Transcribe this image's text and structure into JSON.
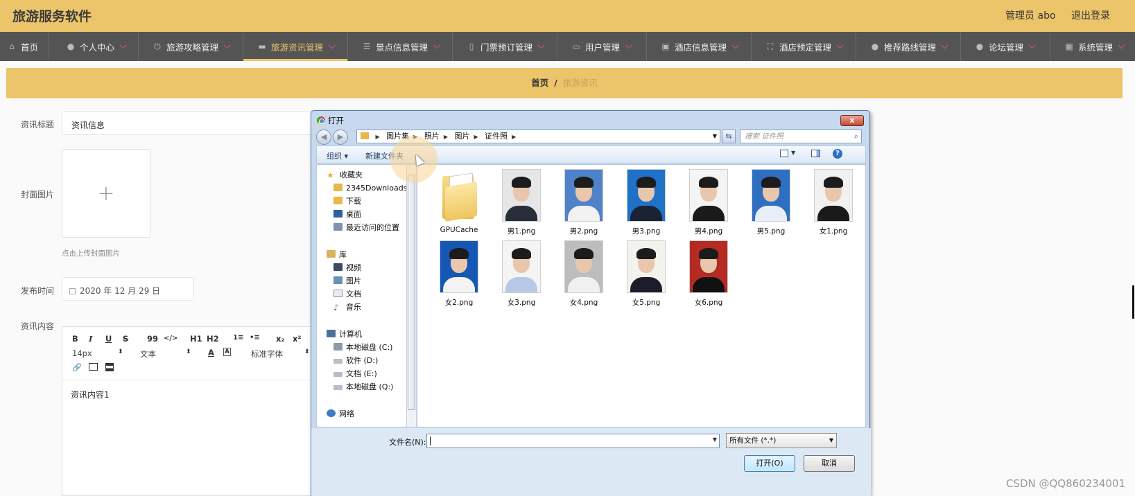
{
  "app": {
    "title": "旅游服务软件"
  },
  "user": {
    "name": "管理员 abo",
    "logout": "退出登录"
  },
  "nav": [
    {
      "label": "首页",
      "icon": "home-icon"
    },
    {
      "label": "个人中心",
      "icon": "user-icon"
    },
    {
      "label": "旅游攻略管理",
      "icon": "power-icon"
    },
    {
      "label": "旅游资讯管理",
      "icon": "news-icon"
    },
    {
      "label": "景点信息管理",
      "icon": "list-icon"
    },
    {
      "label": "门票预订管理",
      "icon": "mic-icon"
    },
    {
      "label": "用户管理",
      "icon": "chat-icon"
    },
    {
      "label": "酒店信息管理",
      "icon": "briefcase-icon"
    },
    {
      "label": "酒店预定管理",
      "icon": "fullscreen-icon"
    },
    {
      "label": "推荐路线管理",
      "icon": "person-icon"
    },
    {
      "label": "论坛管理",
      "icon": "person-icon"
    },
    {
      "label": "系统管理",
      "icon": "grid-icon"
    }
  ],
  "breadcrumb": {
    "home": "首页",
    "sep": "/",
    "current": "旅游资讯"
  },
  "form": {
    "title_label": "资讯标题",
    "title_value": "资讯信息",
    "cover_label": "封面图片",
    "upload_plus": "+",
    "upload_tip": "点击上传封面图片",
    "date_label": "发布时间",
    "date_value": "2020 年 12 月 29 日",
    "content_label": "资讯内容",
    "content_value": "资讯内容1",
    "toolbar": {
      "bold": "B",
      "italic": "I",
      "underline": "U",
      "strike": "S",
      "quote": "99",
      "code": "</>",
      "h1": "H1",
      "h2": "H2",
      "ol": "1≡",
      "ul": "•≡",
      "sub": "x₂",
      "sup": "x²",
      "size": "14px",
      "block": "文本",
      "font": "标准字体"
    }
  },
  "dialog": {
    "title": "打开",
    "close": "x",
    "path": [
      "图片集",
      "照片",
      "图片",
      "证件照"
    ],
    "search_placeholder": "搜索 证件照",
    "organize": "组织 ▾",
    "new_folder": "新建文件夹",
    "nav": {
      "favorites": "收藏夹",
      "fav_items": [
        "2345Downloads",
        "下载",
        "桌面",
        "最近访问的位置"
      ],
      "library": "库",
      "lib_items": [
        "视频",
        "图片",
        "文档",
        "音乐"
      ],
      "computer": "计算机",
      "drives": [
        "本地磁盘 (C:)",
        "软件 (D:)",
        "文档 (E:)",
        "本地磁盘 (Q:)"
      ],
      "network": "网络"
    },
    "files": [
      {
        "name": "GPUCache",
        "kind": "folder"
      },
      {
        "name": "男1.png",
        "kind": "photo",
        "bg": "#e6e6e6",
        "cloth": "#2a2d3a"
      },
      {
        "name": "男2.png",
        "kind": "photo",
        "bg": "#4f82c9",
        "cloth": "#f2f2f2"
      },
      {
        "name": "男3.png",
        "kind": "photo",
        "bg": "#1f72c8",
        "cloth": "#1b2233"
      },
      {
        "name": "男4.png",
        "kind": "photo",
        "bg": "#f4f4f4",
        "cloth": "#1a1a1a"
      },
      {
        "name": "男5.png",
        "kind": "photo",
        "bg": "#2e6fc2",
        "cloth": "#e8eef8"
      },
      {
        "name": "女1.png",
        "kind": "photo",
        "bg": "#f1f1f1",
        "cloth": "#1a1a1a"
      },
      {
        "name": "女2.png",
        "kind": "photo",
        "bg": "#1557b5",
        "cloth": "#f3f3f3"
      },
      {
        "name": "女3.png",
        "kind": "photo",
        "bg": "#f4f4f4",
        "cloth": "#b8c8e8"
      },
      {
        "name": "女4.png",
        "kind": "photo",
        "bg": "#bdbdbd",
        "cloth": "#f0f0f0"
      },
      {
        "name": "女5.png",
        "kind": "photo",
        "bg": "#f3f3ee",
        "cloth": "#1c1c2a"
      },
      {
        "name": "女6.png",
        "kind": "photo",
        "bg": "#b52a22",
        "cloth": "#111111"
      }
    ],
    "filename_label": "文件名(N):",
    "filename_value": "",
    "filetype": "所有文件 (*.*)",
    "open_btn": "打开(O)",
    "cancel_btn": "取消"
  },
  "watermark": "CSDN @QQ860234001"
}
